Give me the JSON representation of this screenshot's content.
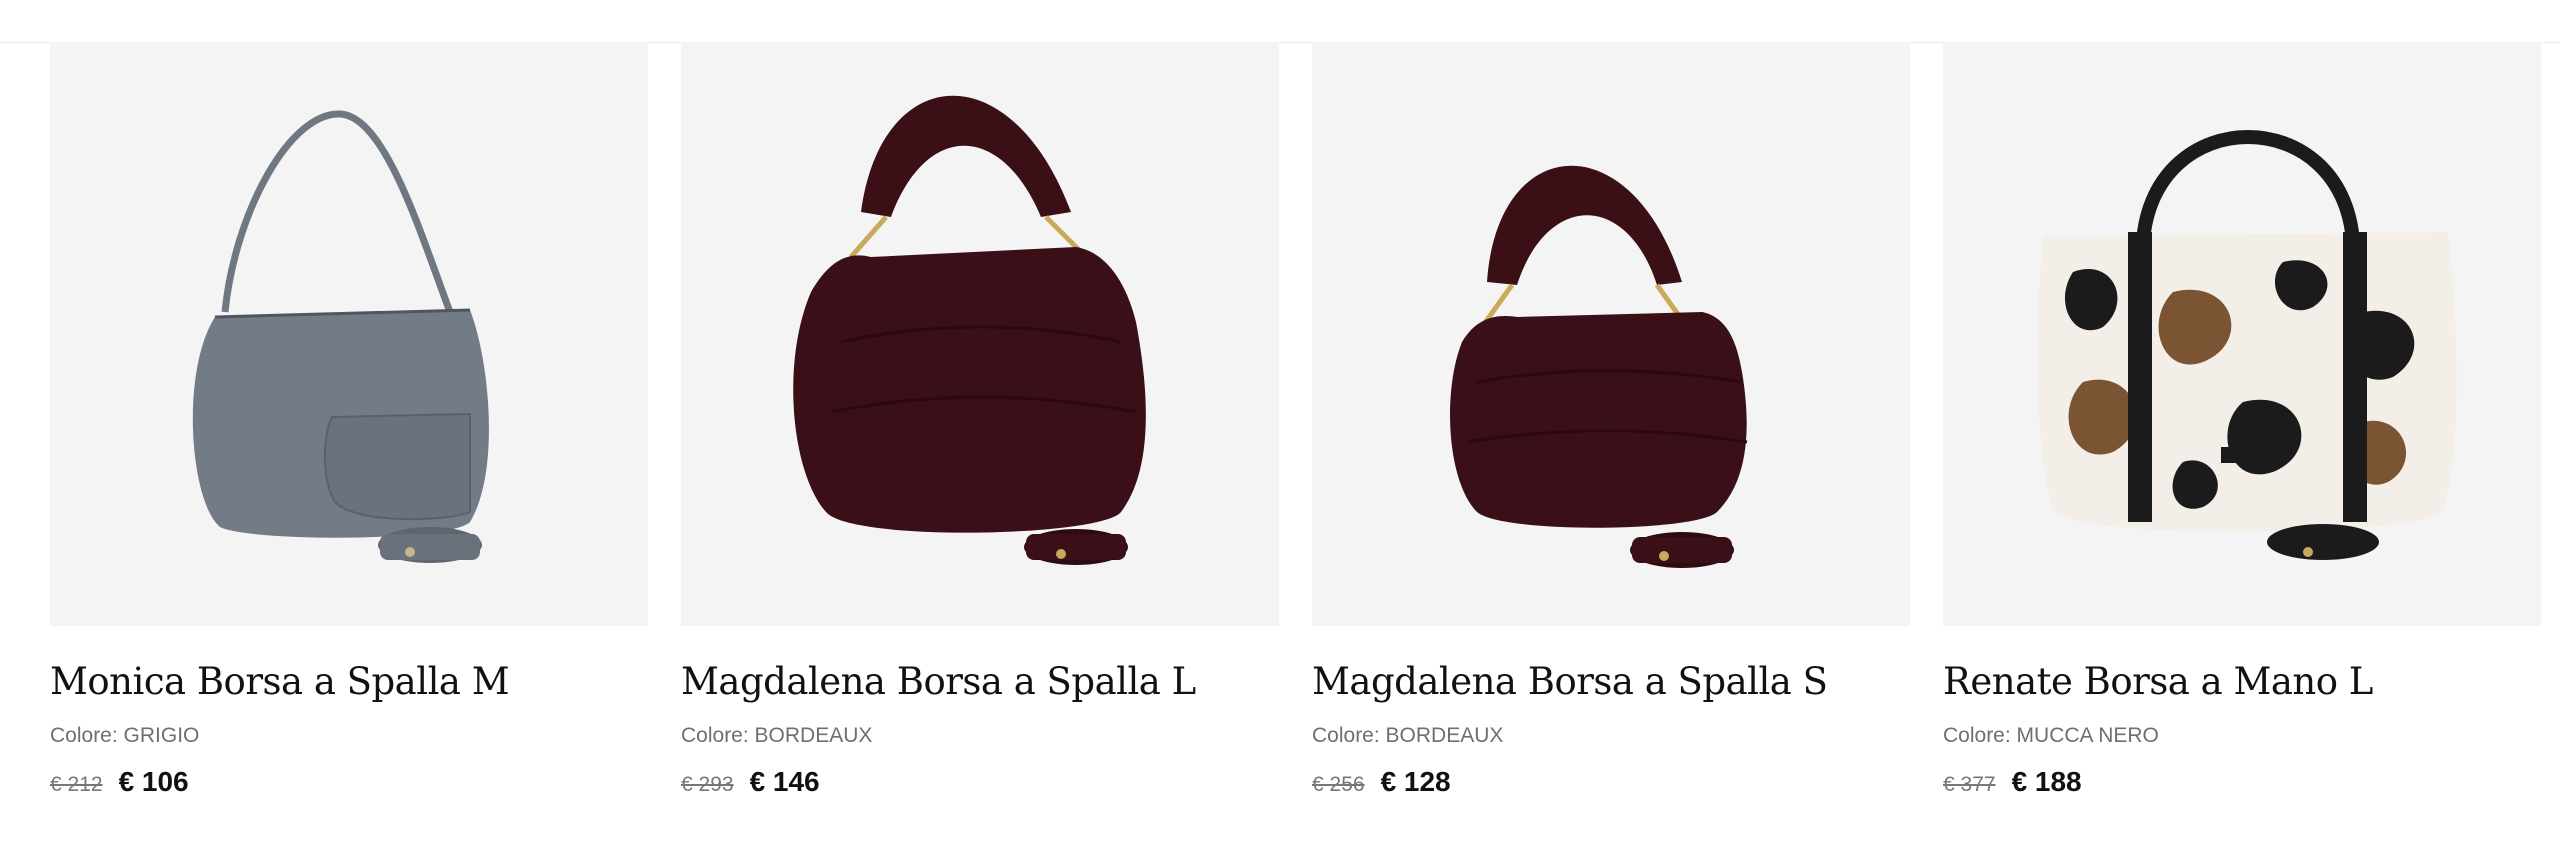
{
  "products": [
    {
      "title": "Monica Borsa a Spalla M",
      "color_label": "Colore: GRIGIO",
      "old_price": "€ 212",
      "price": "€ 106",
      "image_alt": "grey shoulder bag"
    },
    {
      "title": "Magdalena Borsa a Spalla L",
      "color_label": "Colore: BORDEAUX",
      "old_price": "€ 293",
      "price": "€ 146",
      "image_alt": "bordeaux croc shoulder bag large"
    },
    {
      "title": "Magdalena Borsa a Spalla S",
      "color_label": "Colore: BORDEAUX",
      "old_price": "€ 256",
      "price": "€ 128",
      "image_alt": "bordeaux croc shoulder bag small"
    },
    {
      "title": "Renate Borsa a Mano L",
      "color_label": "Colore: MUCCA NERO",
      "old_price": "€ 377",
      "price": "€ 188",
      "image_alt": "cow print tote bag"
    }
  ],
  "colors": {
    "image_bg": "#f4f4f4",
    "grey_bag": "#6f7782",
    "bordeaux": "#3a1016",
    "black_leather": "#1b1b1b"
  }
}
